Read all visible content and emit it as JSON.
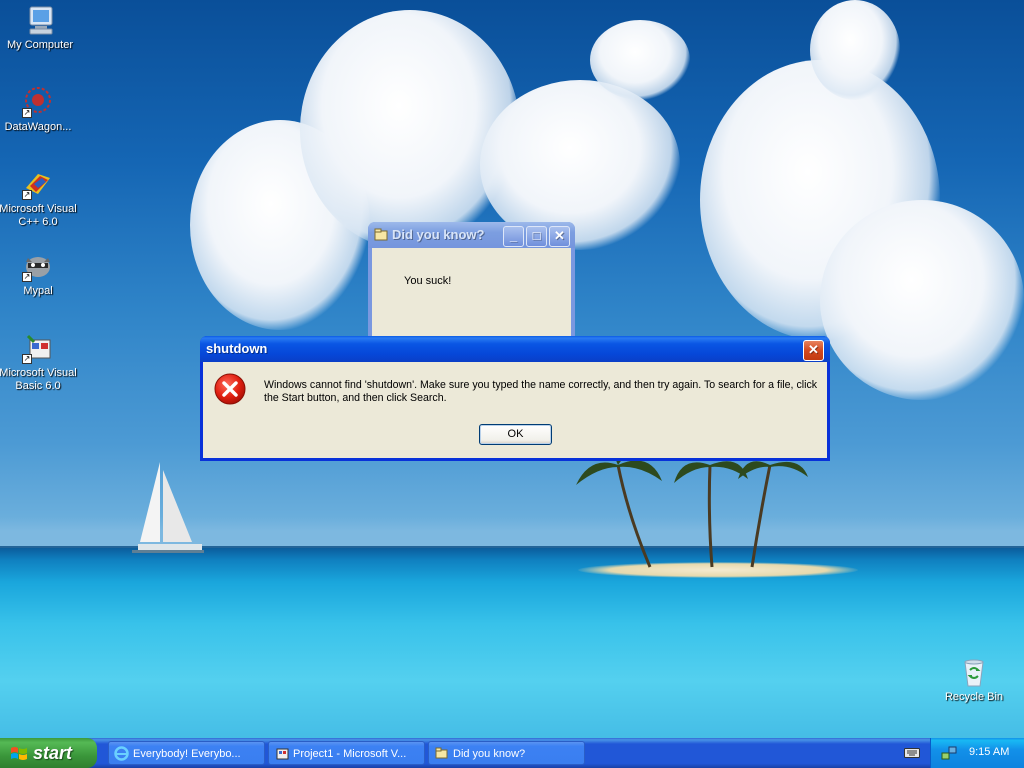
{
  "desktop": {
    "icons": [
      {
        "label": "My Computer"
      },
      {
        "label": "DataWagon..."
      },
      {
        "label": "Microsoft Visual C++ 6.0"
      },
      {
        "label": "Mypal"
      },
      {
        "label": "Microsoft Visual Basic 6.0"
      },
      {
        "label": "Recycle Bin"
      }
    ]
  },
  "dialog_info": {
    "title": "Did you know?",
    "message": "You suck!"
  },
  "dialog_error": {
    "title": "shutdown",
    "message": "Windows cannot find 'shutdown'. Make sure you typed the name correctly, and then try again. To search for a file, click the Start button, and then click Search.",
    "ok_label": "OK"
  },
  "taskbar": {
    "start_label": "start",
    "tasks": [
      {
        "label": "Everybody! Everybo..."
      },
      {
        "label": "Project1 - Microsoft V..."
      },
      {
        "label": "Did you know?"
      }
    ],
    "clock": "9:15 AM"
  },
  "colors": {
    "title_active": "#0a56e4",
    "title_inactive": "#7c9ee0",
    "close_red": "#d4491f",
    "start_green": "#3a963a",
    "taskbar_blue": "#2157d7",
    "dialog_face": "#ece9d8"
  }
}
